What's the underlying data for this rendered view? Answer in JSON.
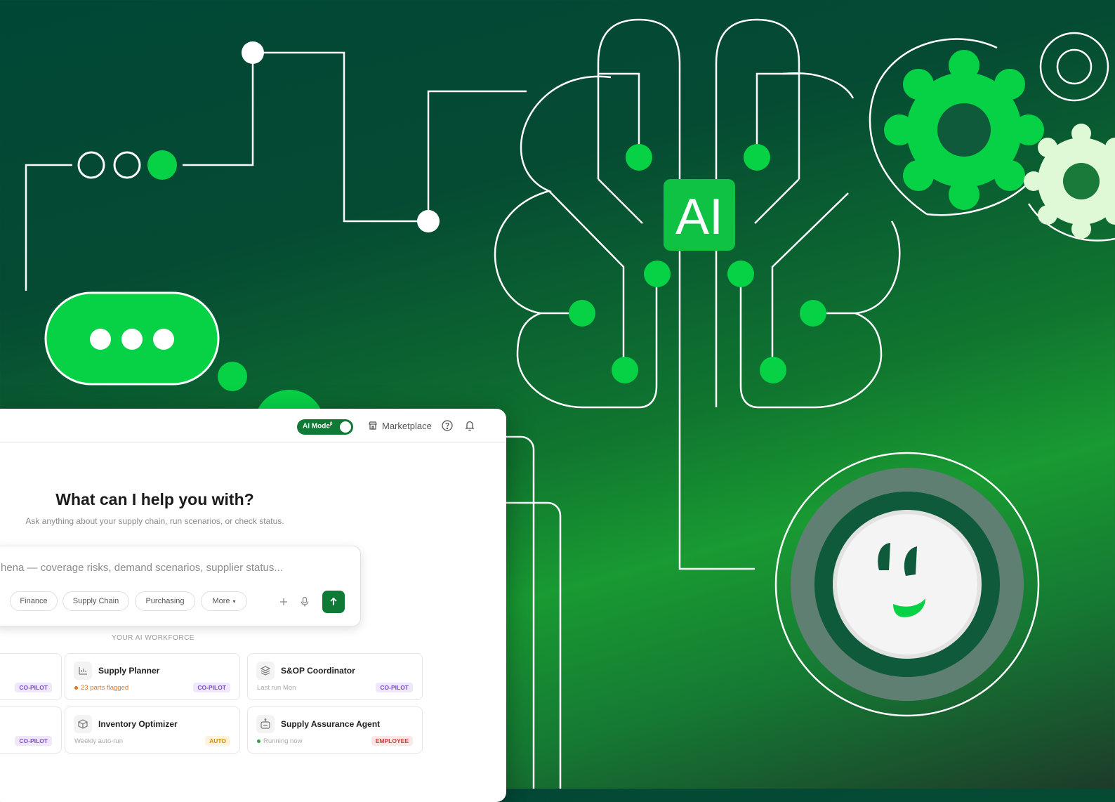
{
  "hero": {
    "ai_badge": "AI"
  },
  "topbar": {
    "ai_mode_label": "AI Mode",
    "ai_mode_sup": "β",
    "ai_mode_on": true,
    "marketplace_label": "Marketplace"
  },
  "main": {
    "title": "What can I help you with?",
    "subtitle": "Ask anything about your supply chain, run scenarios, or check status.",
    "input_placeholder": "hena — coverage risks, demand scenarios, supplier status...",
    "chips": [
      "Finance",
      "Supply Chain",
      "Purchasing",
      "More"
    ],
    "section_label": "YOUR AI WORKFORCE",
    "cards": [
      {
        "name": "",
        "status": "",
        "badge": "CO-PILOT",
        "badge_type": "copilot",
        "icon": "agent-icon"
      },
      {
        "name": "Supply Planner",
        "status": "23 parts flagged",
        "status_color": "#e8741e",
        "badge": "CO-PILOT",
        "badge_type": "copilot",
        "icon": "bar-chart-icon"
      },
      {
        "name": "S&OP Coordinator",
        "status": "Last run Mon",
        "badge": "CO-PILOT",
        "badge_type": "copilot",
        "icon": "layers-icon"
      },
      {
        "name": "",
        "status": "",
        "badge": "CO-PILOT",
        "badge_type": "copilot",
        "icon": "agent-icon"
      },
      {
        "name": "Inventory Optimizer",
        "status": "Weekly auto-run",
        "badge": "AUTO",
        "badge_type": "auto",
        "icon": "box-icon"
      },
      {
        "name": "Supply Assurance Agent",
        "status": "Running now",
        "status_color": "#2f9e44",
        "badge": "EMPLOYEE",
        "badge_type": "emp",
        "icon": "robot-icon"
      }
    ]
  },
  "colors": {
    "brand_green": "#0f7a36",
    "accent_green": "#07d246",
    "pale_green": "#dff8d6"
  }
}
